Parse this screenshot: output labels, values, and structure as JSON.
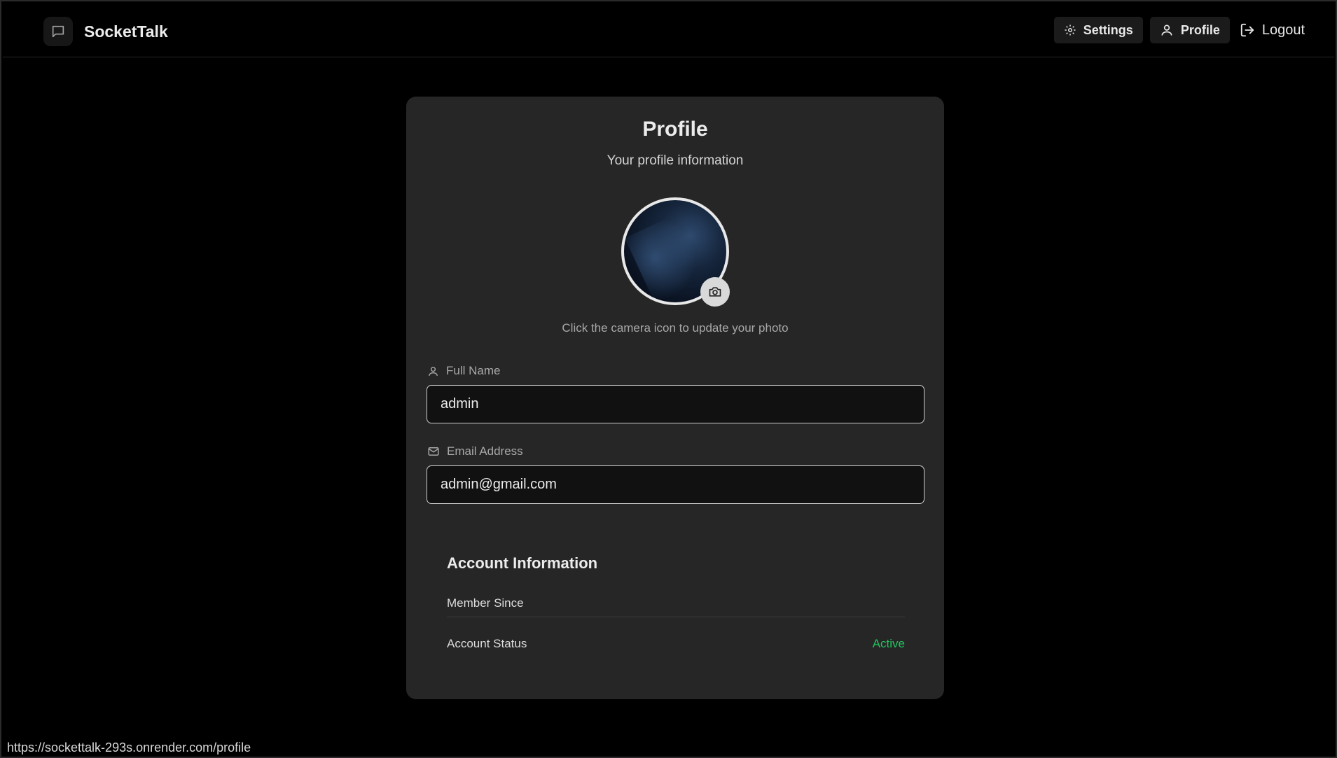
{
  "app": {
    "name": "SocketTalk"
  },
  "nav": {
    "settings_label": "Settings",
    "profile_label": "Profile",
    "logout_label": "Logout"
  },
  "card": {
    "title": "Profile",
    "subtitle": "Your profile information",
    "photo_hint": "Click the camera icon to update your photo"
  },
  "fields": {
    "full_name": {
      "label": "Full Name",
      "value": "admin"
    },
    "email": {
      "label": "Email Address",
      "value": "admin@gmail.com"
    }
  },
  "account": {
    "title": "Account Information",
    "member_since_label": "Member Since",
    "member_since_value": "",
    "status_label": "Account Status",
    "status_value": "Active",
    "status_color": "#22c55e"
  },
  "browser_status": {
    "url": "https://sockettalk-293s.onrender.com/profile"
  },
  "icons": {
    "brand": "chat-bubble-icon",
    "settings": "gear-icon",
    "profile": "user-icon",
    "logout": "logout-icon",
    "camera": "camera-icon",
    "full_name": "user-icon",
    "email": "mail-icon"
  }
}
